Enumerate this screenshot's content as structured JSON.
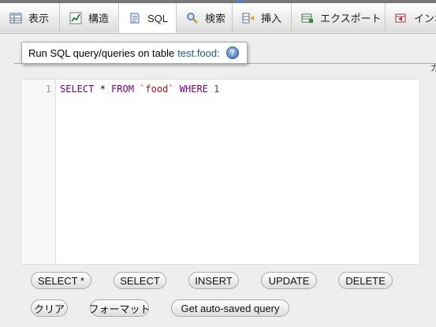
{
  "tabs": [
    {
      "label": "表示",
      "icon": "table-browse-icon"
    },
    {
      "label": "構造",
      "icon": "structure-icon"
    },
    {
      "label": "SQL",
      "icon": "sql-icon",
      "active": true
    },
    {
      "label": "検索",
      "icon": "search-icon"
    },
    {
      "label": "挿入",
      "icon": "insert-icon"
    },
    {
      "label": "エクスポート",
      "icon": "export-icon"
    },
    {
      "label": "インポ",
      "icon": "import-icon"
    }
  ],
  "legend": {
    "text": "Run SQL query/queries on table ",
    "table": "test.food",
    "colon": ":",
    "help_icon": "help-icon",
    "help_glyph": "?"
  },
  "cut_text": "ガ",
  "editor": {
    "line_number": "1",
    "tokens": {
      "select": "SELECT",
      "star": " * ",
      "from": "FROM",
      "sp1": " ",
      "table": "`food`",
      "sp2": " ",
      "where": "WHERE",
      "sp3": " ",
      "one": "1"
    }
  },
  "buttons_row1": [
    "SELECT *",
    "SELECT",
    "INSERT",
    "UPDATE",
    "DELETE"
  ],
  "buttons_row2": [
    "クリア",
    "フォーマット",
    "Get auto-saved query"
  ],
  "colors": {
    "keyword": "#770088",
    "string": "#aa1111",
    "number": "#116644",
    "link": "#235a81"
  }
}
